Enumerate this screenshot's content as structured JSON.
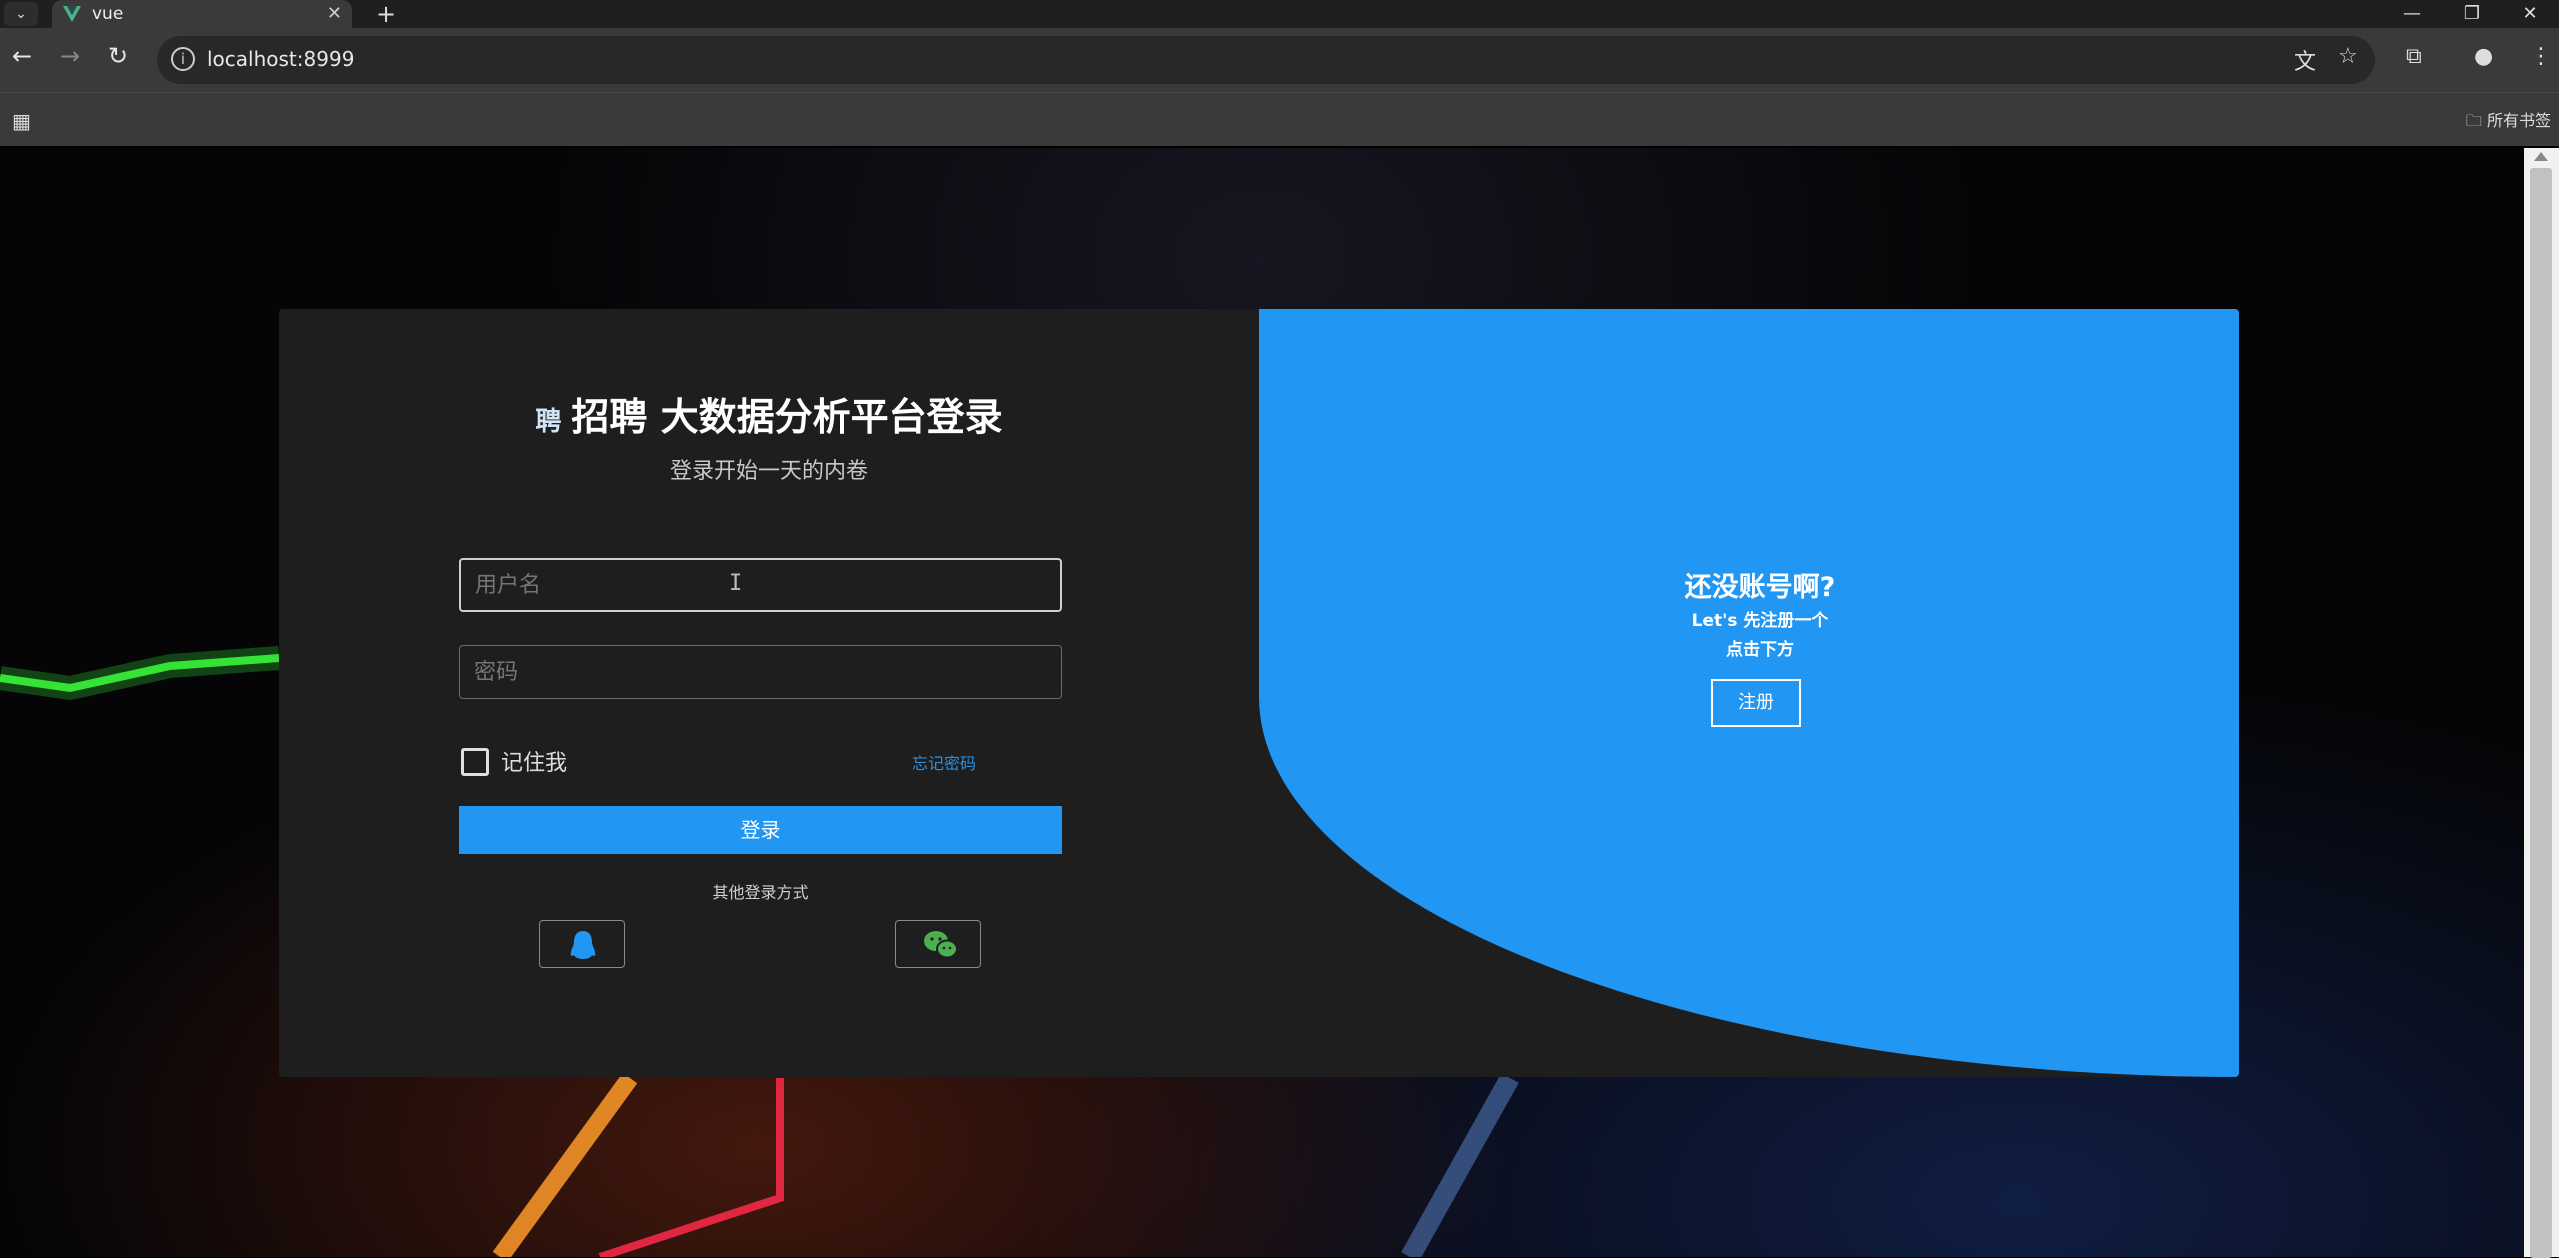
{
  "browser": {
    "tab_title": "vue",
    "url": "localhost:8999",
    "all_bookmarks": "所有书签",
    "icons": [
      "tab-list-icon",
      "vue-logo-icon",
      "close-icon",
      "new-tab-icon",
      "minimize-icon",
      "restore-icon",
      "close-window-icon",
      "back-icon",
      "forward-icon",
      "reload-icon",
      "site-info-icon",
      "translate-icon",
      "star-icon",
      "extensions-icon",
      "profile-icon",
      "menu-icon",
      "apps-icon",
      "folder-icon"
    ]
  },
  "login": {
    "badge": "聘",
    "title": "招聘 大数据分析平台登录",
    "subtitle": "登录开始一天的内卷",
    "username_placeholder": "用户名",
    "password_placeholder": "密码",
    "remember": "记住我",
    "forgot": "忘记密码",
    "submit": "登录",
    "other_methods": "其他登录方式"
  },
  "register": {
    "title": "还没账号啊?",
    "line1": "Let's 先注册一个",
    "line2": "点击下方",
    "button": "注册"
  },
  "colors": {
    "accent": "#2196f3",
    "panel": "#1e1e1e",
    "wechat": "#4caf50"
  }
}
